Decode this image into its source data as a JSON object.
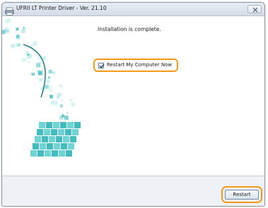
{
  "window": {
    "title": "UFRII LT Printer Driver - Ver. 21.10"
  },
  "content": {
    "message": "Installation is complete.",
    "restart_option": {
      "label": "Restart My Computer Now",
      "checked": true
    }
  },
  "footer": {
    "restart_label": "Restart"
  },
  "colors": {
    "highlight": "#f39a1c",
    "art_primary": "#2fb5b8",
    "art_light": "#b9ece9"
  }
}
